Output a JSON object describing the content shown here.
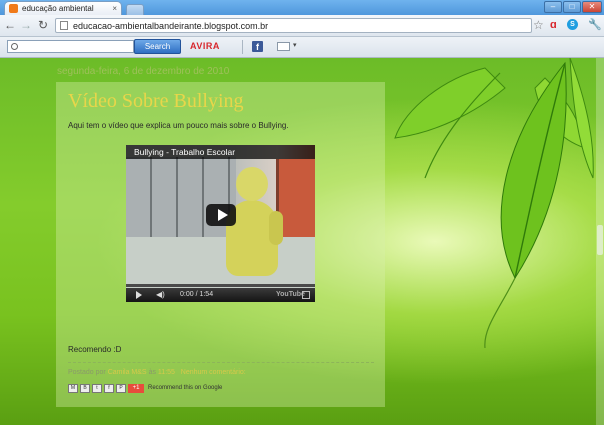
{
  "browser": {
    "tab_title": "educação ambiental",
    "tab_close": "×",
    "url": "educacao-ambientalbandeirante.blogspot.com.br",
    "window_controls": {
      "minimize": "–",
      "maximize": "□",
      "close": "✕"
    },
    "nav_icons": {
      "back": "←",
      "forward": "→",
      "reload": "↻",
      "star": "☆",
      "wrench": "🔧"
    }
  },
  "toolbar": {
    "search_button": "Search",
    "avira_label": "AVIRA",
    "facebook_label": "f",
    "mail_dropdown": "▾"
  },
  "blog": {
    "date_header": "segunda-feira, 6 de dezembro de 2010",
    "post_title": "Vídeo Sobre Bullying",
    "intro_text": "Aqui tem o vídeo que explica um pouco mais sobre o Bullying.",
    "video": {
      "title": "Bullying - Trabalho Escolar",
      "time": "0:00 / 1:54",
      "logo": "YouTube",
      "progress": 0
    },
    "closing_text": "Recomendo :D",
    "footer": {
      "posted_by": "Postado por",
      "author": "Camila M&S",
      "at": "às",
      "time": "11:55",
      "comments": "Nenhum comentário:"
    },
    "share": {
      "icons": [
        "M",
        "B",
        "t",
        "f",
        "P"
      ],
      "gplus_label": "+1",
      "recommend_text": "Recommend this on Google"
    }
  }
}
